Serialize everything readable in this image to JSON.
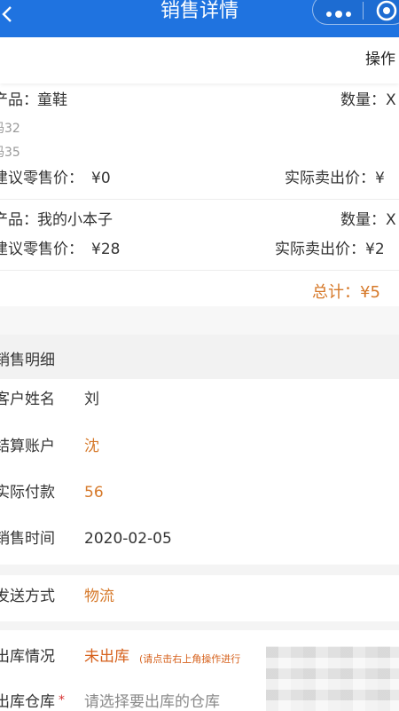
{
  "nav": {
    "title": "销售详情",
    "more_icon": "more-dots-icon",
    "close_icon": "target-circle-icon",
    "back_icon": "back-chevron-icon"
  },
  "toolbar": {
    "operation_label": "操作"
  },
  "products": [
    {
      "name_label": "产品：",
      "name_value": "童鞋",
      "quantity_label": "数量：X",
      "sizes": [
        "码32",
        "码35"
      ],
      "suggested_price_label": "建议零售价：",
      "suggested_price_value": "¥0",
      "actual_price_label": "实际卖出价：¥"
    },
    {
      "name_label": "产品：",
      "name_value": "我的小本子",
      "quantity_label": "数量：X",
      "suggested_price_label": "建议零售价：",
      "suggested_price_value": "¥28",
      "actual_price_label": "实际卖出价：¥2"
    }
  ],
  "total": {
    "label": "总计：¥5"
  },
  "details": {
    "section_title": "销售明细",
    "customer_label": "客户姓名",
    "customer_value": "刘",
    "account_label": "结算账户",
    "account_value": "沈",
    "payment_label": "实际付款",
    "payment_value": "56",
    "time_label": "销售时间",
    "time_value": "2020-02-05",
    "shipping_label": "发送方式",
    "shipping_value": "物流",
    "outbound_label": "出库情况",
    "outbound_value": "未出库",
    "outbound_hint": "(请点击右上角操作进行",
    "warehouse_label": "出库仓库",
    "warehouse_required": "*",
    "warehouse_placeholder": "请选择要出库的仓库"
  },
  "colors": {
    "nav": "#1f73e0",
    "accent": "#d6792a",
    "text": "#333333",
    "muted": "#999999"
  }
}
